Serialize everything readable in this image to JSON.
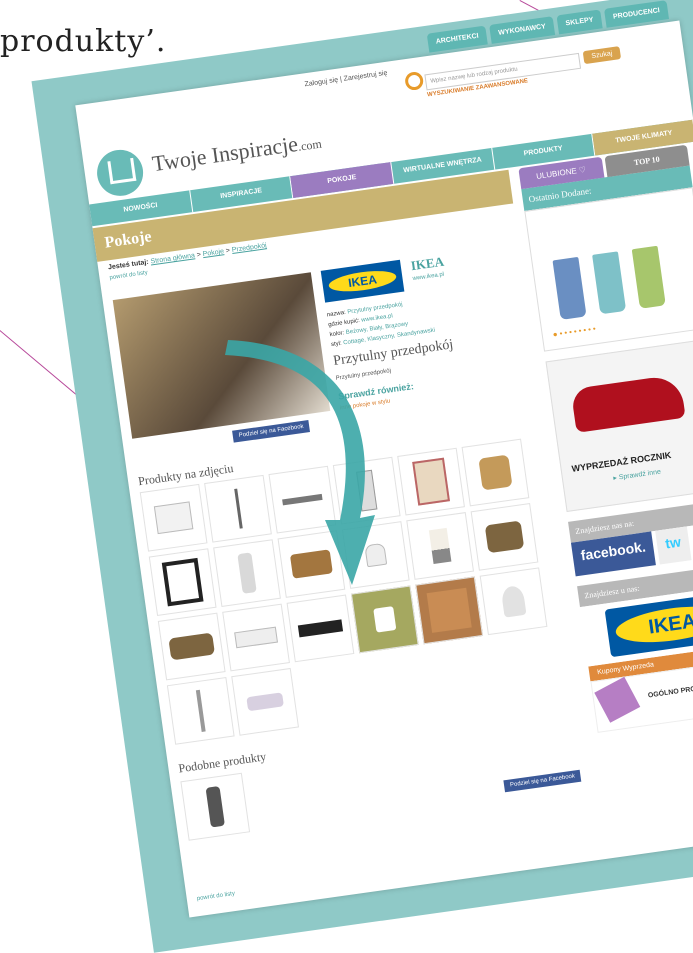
{
  "caption": "produkty’.",
  "top_tabs": [
    "ARCHITEKCI",
    "WYKONAWCY",
    "SKLEPY",
    "PRODUCENCI"
  ],
  "header": {
    "login": "Zaloguj się",
    "register": "Zarejestruj się",
    "search_placeholder": "Wpisz nazwę lub rodzaj produktu",
    "search_button": "Szukaj",
    "advanced": "WYSZUKIWANIE ZAAWANSOWANE",
    "logo_text": "Twoje Inspiracje",
    "logo_suffix": ".com"
  },
  "nav": [
    "NOWOŚCI",
    "INSPIRACJE",
    "POKOJE",
    "WIRTUALNE WNĘTRZA",
    "PRODUKTY",
    "TWOJE KLIMATY"
  ],
  "main": {
    "title": "Pokoje",
    "breadcrumb_prefix": "Jesteś tutaj:",
    "breadcrumb": [
      "Strona główna",
      "Pokoje",
      "Przedpokój"
    ],
    "back": "powrót do listy",
    "facebook_share": "Podziel się na Facebook",
    "brand": "IKEA",
    "brand_url": "www.ikea.pl",
    "logo_word": "IKEA",
    "meta_labels": [
      "nazwa:",
      "gdzie kupić:",
      "kolor:",
      "styl:"
    ],
    "meta_values": [
      "Przytulny przedpokój",
      "www.ikea.pl",
      "Beżowy, Biały, Brązowy",
      "Cottage, Klasyczny, Skandynawski"
    ],
    "product_title": "Przytulny przedpokój",
    "product_subtitle": "Przytulny przedpokój",
    "see_also": "Sprawdź również:",
    "see_also_link": "inne pokoje w stylu",
    "products_heading": "Produkty na zdjęciu",
    "similar_heading": "Podobne produkty",
    "facebook_share_2": "Podziel się na Facebook",
    "back_bottom": "powrót do listy"
  },
  "sidebar": {
    "tab_fav": "ULUBIONE ♡",
    "tab_top": "TOP 10",
    "recent_heading": "Ostatnio Dodane:",
    "ad_text": "WYPRZEDAŻ ROCZNIK",
    "ad_link": "▸ Sprawdź inne",
    "find_us": "Znajdziesz nas na:",
    "facebook": "facebook.",
    "twitter": "tw",
    "find_us_2": "Znajdziesz u nas:",
    "ikea": "IKEA",
    "coupons": "Kupony Wyprzeda",
    "promo": "OGÓLNO PRO"
  },
  "colors": {
    "teal": "#69bbb7",
    "gold": "#c9b472",
    "purple": "#9b7cc0",
    "accent_line": "#b7499a"
  }
}
